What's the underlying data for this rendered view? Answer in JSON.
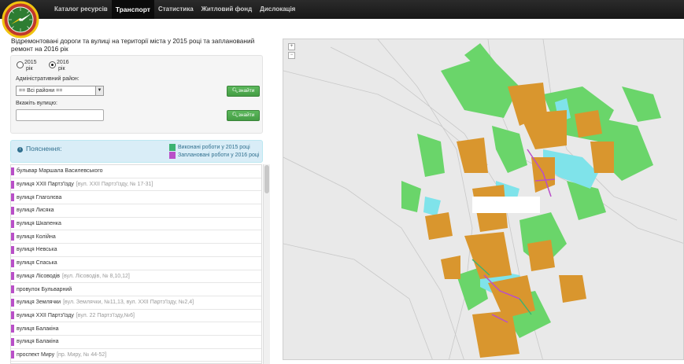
{
  "nav": {
    "items": [
      {
        "label": "Каталог ресурсів",
        "active": false
      },
      {
        "label": "Транспорт",
        "active": true
      },
      {
        "label": "Статистика",
        "active": false
      },
      {
        "label": "Житловий фонд",
        "active": false
      },
      {
        "label": "Дислокація",
        "active": false
      }
    ]
  },
  "page": {
    "title_line1": "Відремонтовані дороги та вулиці на території міста у 2015 році та запланований",
    "title_line2": "ремонт на 2016 рік"
  },
  "form": {
    "year_2015": {
      "value": "2015",
      "unit": "рік",
      "checked": false
    },
    "year_2016": {
      "value": "2016",
      "unit": "рік",
      "checked": true
    },
    "district_label": "Адміністративний район:",
    "district_selected": "== Всі райони ==",
    "street_label": "Вкажіть вулицю:",
    "street_value": "",
    "find_label": "знайти"
  },
  "legend": {
    "title": "Пояснення:",
    "done": "Виконані роботи у 2015 році",
    "planned": "Заплановані роботи у 2016 році",
    "done_color": "#3cb371",
    "planned_color": "#b94fc8"
  },
  "streets": [
    {
      "name": "бульвар Маршала Василевського",
      "addr": ""
    },
    {
      "name": "вулиця XXII Партз'їзду",
      "addr": "[вул. XXII Партз'їзду, № 17-31]"
    },
    {
      "name": "вулиця Глаголєва",
      "addr": ""
    },
    {
      "name": "вулиця Лисяка",
      "addr": ""
    },
    {
      "name": "вулиця Шкапенка",
      "addr": ""
    },
    {
      "name": "вулиця Колійна",
      "addr": ""
    },
    {
      "name": "вулиця Невська",
      "addr": ""
    },
    {
      "name": "вулиця Спаська",
      "addr": ""
    },
    {
      "name": "вулиця Лісоводів",
      "addr": "[вул. Лісоводів, № 8,10,12]"
    },
    {
      "name": "провулок Бульварний",
      "addr": ""
    },
    {
      "name": "вулиця Землячки",
      "addr": "[вул. Землячки, №11,13, вул. XXII Партз'їзду, №2,4]"
    },
    {
      "name": "вулиця XXII Партз'їзду",
      "addr": "[вул. 22 Партз'їзду,№6]"
    },
    {
      "name": "вулиця Балакіна",
      "addr": ""
    },
    {
      "name": "вулиця Балакіна",
      "addr": ""
    },
    {
      "name": "проспект Миру",
      "addr": "[пр. Миру, № 44-52]"
    }
  ],
  "map": {
    "zoom_in": "+",
    "zoom_out": "−"
  }
}
